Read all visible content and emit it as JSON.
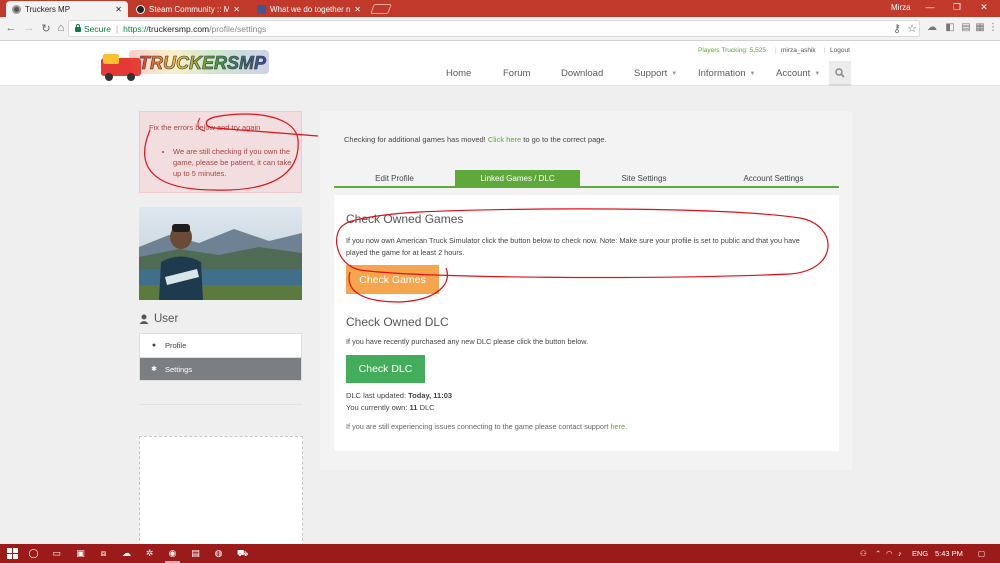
{
  "browser": {
    "tabs": [
      {
        "label": "Truckers MP",
        "active": true
      },
      {
        "label": "Steam Community :: Mirz",
        "active": false
      },
      {
        "label": "What we do together ma",
        "active": false
      }
    ],
    "profile_name": "Mirza",
    "secure_label": "Secure",
    "url_scheme": "https://",
    "url_host": "truckersmp.com",
    "url_path": "/profile/settings"
  },
  "header": {
    "players_trucking_label": "Players Trucking:",
    "players_trucking_count": "5,525",
    "username": "mirza_ashik",
    "logout": "Logout",
    "nav": {
      "home": "Home",
      "forum": "Forum",
      "download": "Download",
      "support": "Support",
      "information": "Information",
      "account": "Account"
    }
  },
  "sidebar": {
    "error_title": "Fix the errors below and try again",
    "error_item": "We are still checking if you own the game, please be patient, it can take up to 5 minutes.",
    "user_heading": "User",
    "menu": {
      "profile": "Profile",
      "settings": "Settings"
    }
  },
  "main": {
    "notice_text": "Checking for additional games has moved!",
    "notice_link": "Click here",
    "notice_tail": "to go to the correct page.",
    "tabs": {
      "edit_profile": "Edit Profile",
      "linked_games": "Linked Games / DLC",
      "site_settings": "Site Settings",
      "account_settings": "Account Settings"
    },
    "owned_games": {
      "heading": "Check Owned Games",
      "text": "If you now own American Truck Simulator click the button below to check now. Note: Make sure your profile is set to public and that you have played the game for at least 2 hours.",
      "button": "Check Games"
    },
    "owned_dlc": {
      "heading": "Check Owned DLC",
      "text": "If you have recently purchased any new DLC please click the button below.",
      "button": "Check DLC",
      "last_updated_label": "DLC last updated:",
      "last_updated_value": "Today, 11:03",
      "own_label": "You currently own:",
      "own_value": "11",
      "own_unit": "DLC"
    },
    "support_text": "If you are still experiencing issues connecting to the game please contact support",
    "support_link": "here."
  },
  "taskbar": {
    "language": "ENG",
    "time": "5:43 PM"
  },
  "colors": {
    "accent_green": "#5fa83a",
    "tabbar_red": "#c0392b",
    "button_orange": "#f5a54e",
    "button_green": "#44ad5c"
  }
}
